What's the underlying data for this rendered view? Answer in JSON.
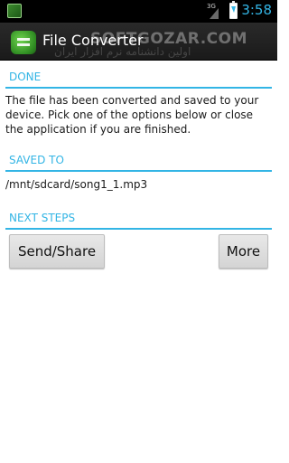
{
  "status_bar": {
    "network_label": "3G",
    "time": "3:58",
    "icons": [
      "notification-icon",
      "signal-icon",
      "battery-charging-icon"
    ]
  },
  "action_bar": {
    "title": "File Converter",
    "icon": "app-icon"
  },
  "watermark": {
    "text": "SOFTGOZAR.COM",
    "subtitle": "اولین دانشنامه نرم افزار ایران"
  },
  "sections": {
    "done": {
      "header": "DONE",
      "message": "The file has been converted and saved to your device. Pick one of the options below or close the application if you are finished."
    },
    "saved_to": {
      "header": "SAVED TO",
      "path": "/mnt/sdcard/song1_1.mp3"
    },
    "next_steps": {
      "header": "NEXT STEPS",
      "send_share_label": "Send/Share",
      "more_label": "More"
    }
  },
  "colors": {
    "accent": "#33b5e5",
    "status_bar": "#000000",
    "action_bar": "#1f1f1f",
    "background": "#ffffff"
  }
}
